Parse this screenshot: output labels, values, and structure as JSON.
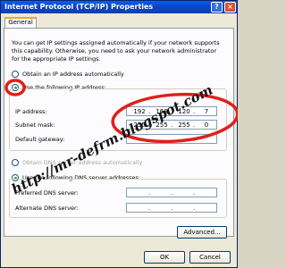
{
  "window": {
    "title": "Internet Protocol (TCP/IP) Properties",
    "help_icon": "?",
    "close_icon": "×"
  },
  "tabs": [
    {
      "label": "General"
    }
  ],
  "intro_text": "You can get IP settings assigned automatically if your network supports this capability. Otherwise, you need to ask your network administrator for the appropriate IP settings.",
  "ip_mode": {
    "auto_label": "Obtain an IP address automatically",
    "manual_label": "Use the following IP address:",
    "selected": "manual"
  },
  "fields": {
    "ip_address": {
      "label": "IP address:",
      "octets": [
        "192",
        "168",
        "120",
        "7"
      ]
    },
    "subnet_mask": {
      "label": "Subnet mask:",
      "octets": [
        "255",
        "255",
        "255",
        "0"
      ]
    },
    "default_gateway": {
      "label": "Default gateway:",
      "octets": [
        "",
        "",
        "",
        ""
      ]
    }
  },
  "dns_mode": {
    "auto_label": "Obtain DNS server address automatically",
    "manual_label": "Use the following DNS server addresses:",
    "selected": "manual"
  },
  "dns_fields": {
    "preferred": {
      "label": "Preferred DNS server:",
      "octets": [
        "",
        "",
        "",
        ""
      ]
    },
    "alternate": {
      "label": "Alternate DNS server:",
      "octets": [
        "",
        "",
        "",
        ""
      ]
    }
  },
  "buttons": {
    "advanced": "Advanced...",
    "ok": "OK",
    "cancel": "Cancel"
  },
  "watermark": "http://mr-defrm.blogspot.com",
  "highlight_color": "#e0201c"
}
